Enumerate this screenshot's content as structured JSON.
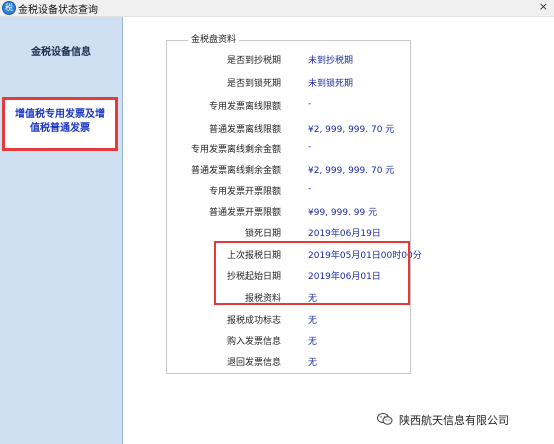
{
  "window": {
    "title": "金税设备状态查询",
    "close_glyph": "×",
    "app_icon_glyph": "税"
  },
  "sidebar": {
    "items": [
      {
        "label": "金税设备信息"
      },
      {
        "label_line1": "增值税专用发票及增",
        "label_line2": "值税普通发票"
      }
    ]
  },
  "panel": {
    "title": "金税盘资料",
    "rows": [
      {
        "label": "是否到抄税期",
        "value": "未到抄税期"
      },
      {
        "label": "是否到锁死期",
        "value": "未到锁死期"
      },
      {
        "label": "专用发票离线限额",
        "value": "-"
      },
      {
        "label": "普通发票离线限额",
        "value": "¥2, 999, 999. 70 元"
      },
      {
        "label": "专用发票离线剩余金额",
        "value": "-"
      },
      {
        "label": "普通发票离线剩余金额",
        "value": "¥2, 999, 999. 70 元"
      },
      {
        "label": "专用发票开票限额",
        "value": "-"
      },
      {
        "label": "普通发票开票限额",
        "value": "¥99, 999. 99 元"
      },
      {
        "label": "锁死日期",
        "value": "2019年06月19日"
      },
      {
        "label": "上次报税日期",
        "value": "2019年05月01日00时00分"
      },
      {
        "label": "抄税起始日期",
        "value": "2019年06月01日"
      },
      {
        "label": "报税资料",
        "value": "无"
      },
      {
        "label": "报税成功标志",
        "value": "无"
      },
      {
        "label": "购入发票信息",
        "value": "无"
      },
      {
        "label": "退回发票信息",
        "value": "无"
      }
    ]
  },
  "watermark": {
    "text": "陕西航天信息有限公司",
    "icon": "wechat-icon"
  }
}
